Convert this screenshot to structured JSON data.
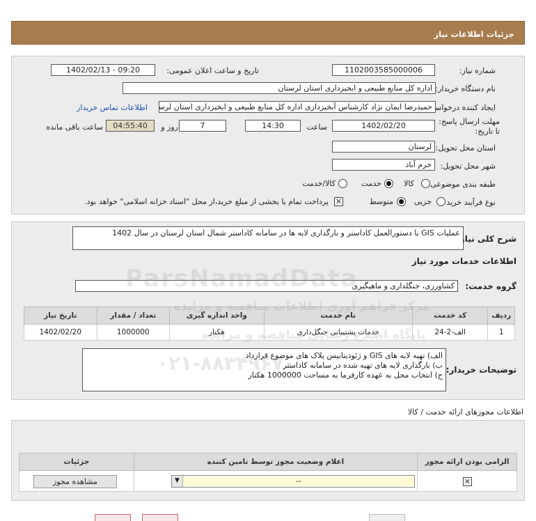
{
  "header": {
    "title": "جزئیات اطلاعات نیاز"
  },
  "form": {
    "need_number_label": "شماره نیاز:",
    "need_number": "1102003585000006",
    "announce_label": "تاریخ و ساعت اعلان عمومی:",
    "announce_value": "1402/02/13 - 09:20",
    "buyer_org_label": "نام دستگاه خریدار:",
    "buyer_org": "اداره کل منابع طبیعی و ابخیزداری استان لرستان",
    "creator_label": "ایجاد کننده درخواست:",
    "creator": "حمیدرضا ایمان نژاد کارشناس آبخیزداری اداره کل منابع طبیعی و ابخیزداری استان لرستان",
    "contact_link": "اطلاعات تماس خریدار",
    "deadline_label": "مهلت ارسال پاسخ: تا تاریخ:",
    "deadline_date": "1402/02/20",
    "time_label": "ساعت",
    "deadline_time": "14:30",
    "days_value": "7",
    "days_label": "روز و",
    "remaining_time": "04:55:40",
    "remaining_label": "ساعت باقی مانده",
    "province_label": "استان محل تحویل:",
    "province": "لرستان",
    "city_label": "شهر محل تحویل:",
    "city": "خرم آباد",
    "category_label": "طبقه بندی موضوعی:",
    "category_options": [
      "کالا",
      "خدمت",
      "کالا/خدمت"
    ],
    "category_selected": "خدمت",
    "process_label": "نوع فرآیند خرید :",
    "process_options": [
      "جزیی",
      "متوسط"
    ],
    "process_selected": "متوسط",
    "treasury_note": "پرداخت تمام یا بخشی از مبلغ خرید،از محل \"اسناد خزانه اسلامی\" خواهد بود."
  },
  "summary": {
    "label": "شرح کلی نیاز:",
    "text": "عملیات GIS با دستورالعمل کاداستر و بارگذاری لایه ها در سامانه کاداستر شمال استان لرستان در سال 1402"
  },
  "services": {
    "section_title": "اطلاعات خدمات مورد نیاز",
    "group_label": "گروه خدمت:",
    "group_value": "کشاورزی، جنگلداری و ماهیگیری",
    "table": {
      "headers": [
        "ردیف",
        "کد خدمت",
        "نام خدمت",
        "واحد اندازه گیری",
        "تعداد / مقدار",
        "تاریخ نیاز"
      ],
      "rows": [
        [
          "1",
          "الف-2-24",
          "خدمات پشتیبانی جنگل‌داری",
          "هکتار",
          "1000000",
          "1402/02/20"
        ]
      ]
    }
  },
  "buyer_notes": {
    "label": "توضیحات خریدار:",
    "lines": [
      "الف) تهیه لایه های GIS و ژئودیتابیس پلاک های موضوع قرارداد",
      "ب) بارگذاری لایه های تهیه شده در سامانه کاداستر",
      "ج) انتخاب محل به عهده کارفرما به مساحت 1000000 هکتار"
    ]
  },
  "licenses": {
    "section_title": "اطلاعات مجوزهای ارائه خدمت / کالا",
    "headers": [
      "الزامی بودن ارائه مجوز",
      "اعلام وضعیت مجوز توسط تامین کننده",
      "جزئیات"
    ],
    "select_value": "--",
    "view_button": "مشاهده مجوز"
  },
  "watermark": {
    "line1": "ParsNamadData",
    "line2": "مرکز فراهم آوری اطلاعات مناقصه و مزایده",
    "line3": "پایگاه اطلاع رسانی مناقصه و مزایده",
    "phone": "۰۲۱-۸۸۳۴۹۶۷۰"
  }
}
